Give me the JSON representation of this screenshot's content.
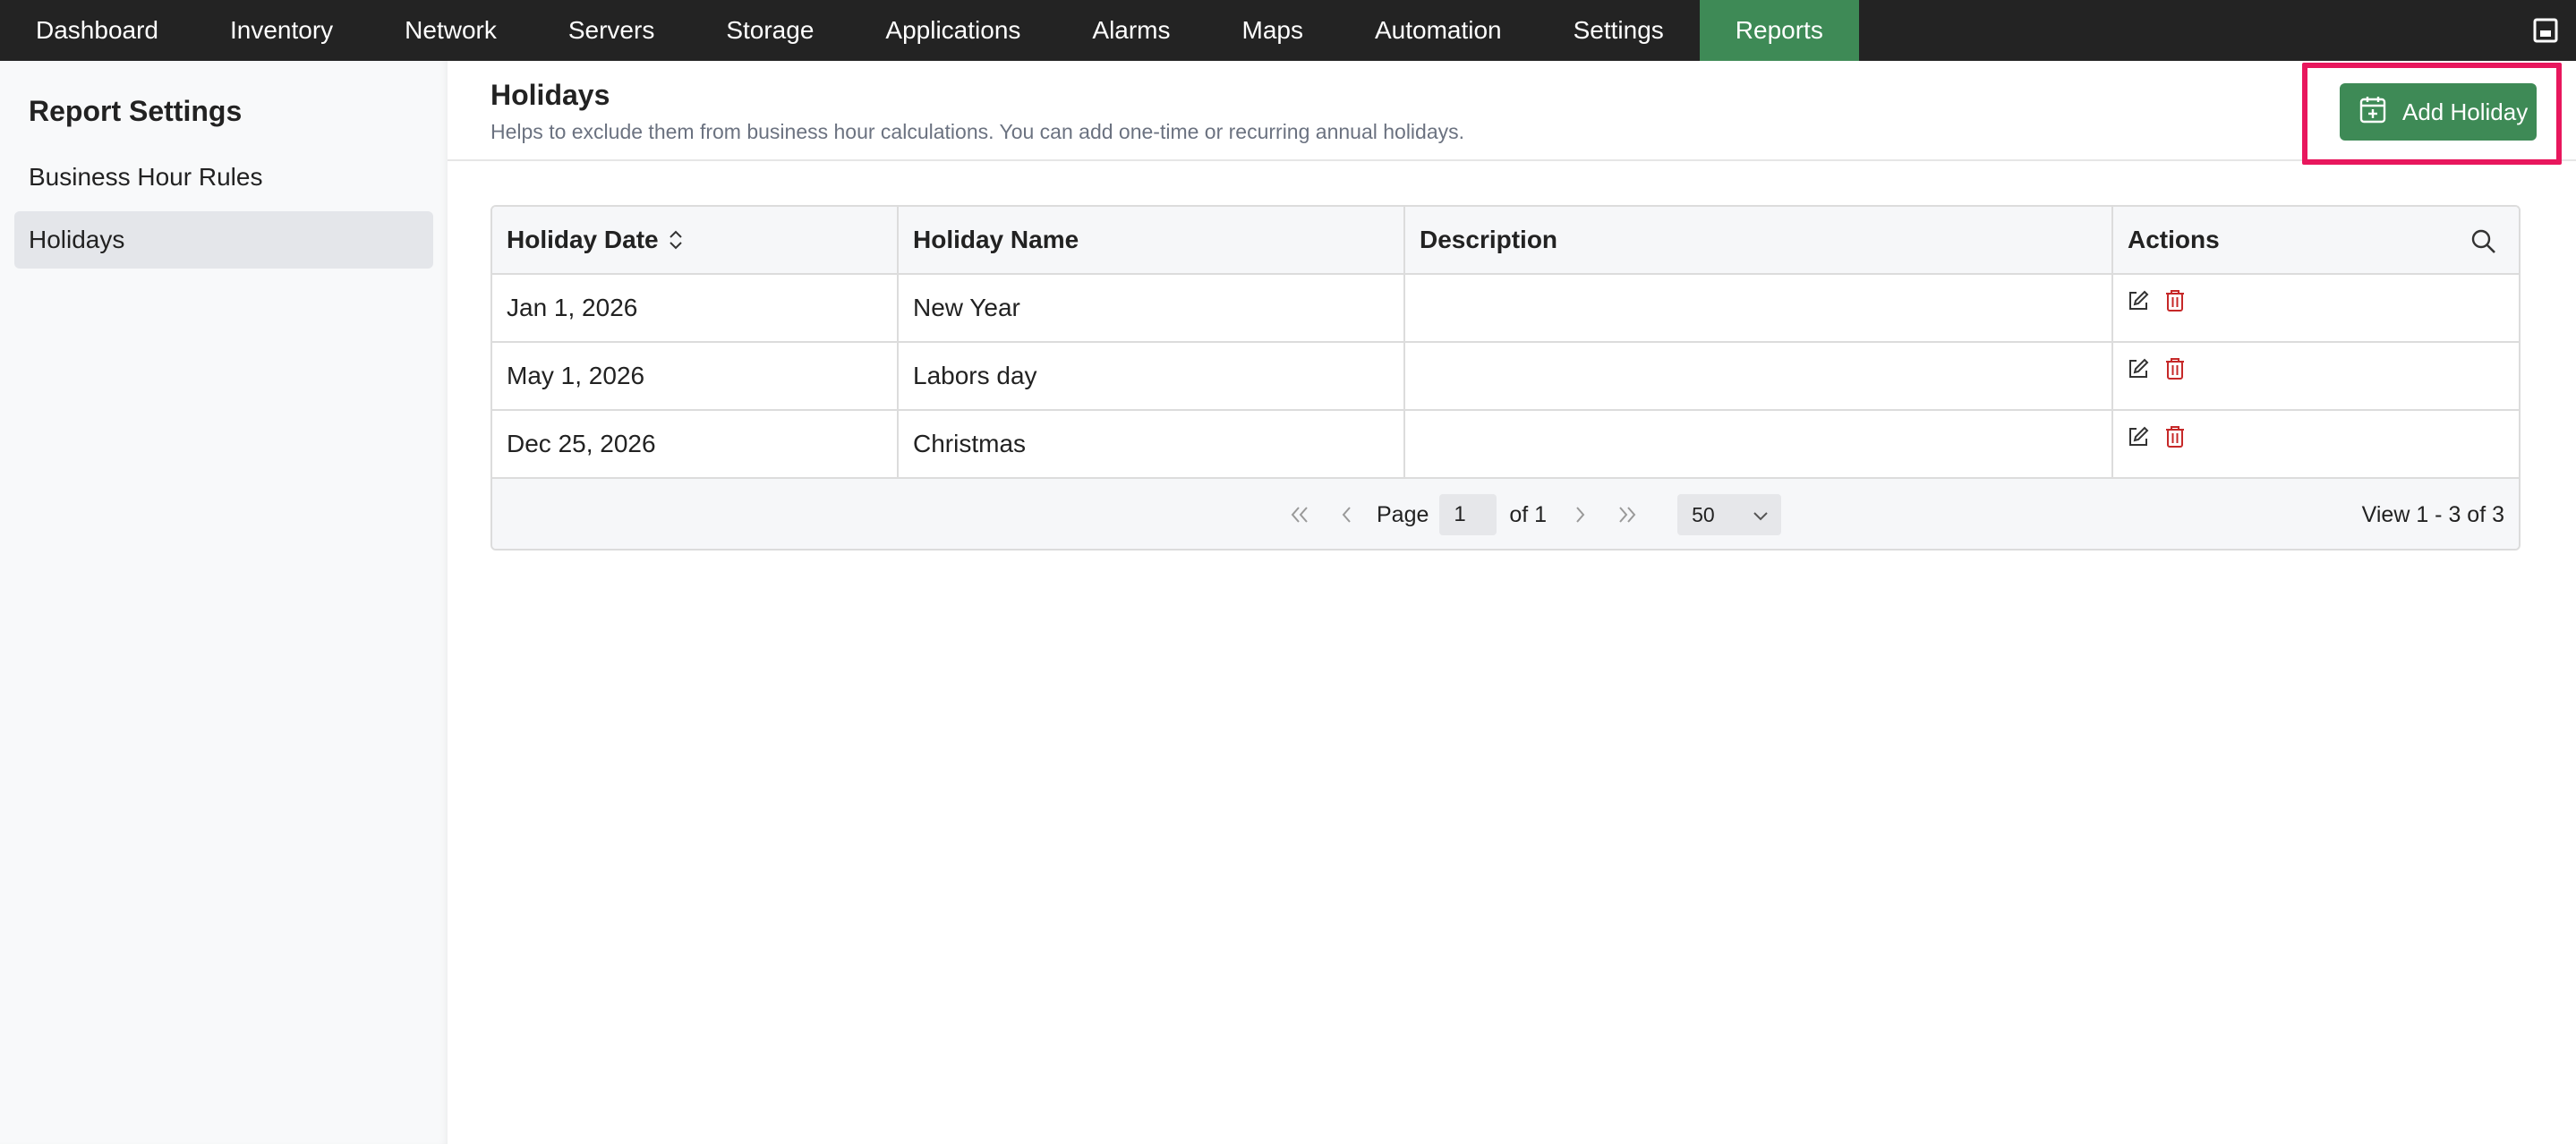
{
  "nav": {
    "tabs": [
      {
        "label": "Dashboard"
      },
      {
        "label": "Inventory"
      },
      {
        "label": "Network"
      },
      {
        "label": "Servers"
      },
      {
        "label": "Storage"
      },
      {
        "label": "Applications"
      },
      {
        "label": "Alarms"
      },
      {
        "label": "Maps"
      },
      {
        "label": "Automation"
      },
      {
        "label": "Settings"
      },
      {
        "label": "Reports"
      }
    ],
    "active_tab": "Reports"
  },
  "sidebar": {
    "title": "Report Settings",
    "items": [
      {
        "label": "Business Hour Rules"
      },
      {
        "label": "Holidays"
      }
    ],
    "active_item": "Holidays"
  },
  "header": {
    "title": "Holidays",
    "subtitle": "Helps to exclude them from business hour calculations. You can add one-time or recurring annual holidays.",
    "add_button_label": "Add Holiday"
  },
  "table": {
    "columns": [
      "Holiday Date",
      "Holiday Name",
      "Description",
      "Actions"
    ],
    "rows": [
      {
        "date": "Jan 1, 2026",
        "name": "New Year",
        "description": ""
      },
      {
        "date": "May 1, 2026",
        "name": "Labors day",
        "description": ""
      },
      {
        "date": "Dec 25, 2026",
        "name": "Christmas",
        "description": ""
      }
    ]
  },
  "pager": {
    "page_label": "Page",
    "page_value": "1",
    "of_label": "of 1",
    "page_size": "50",
    "view_text": "View 1 - 3 of 3"
  },
  "colors": {
    "nav_bg": "#232323",
    "accent_green": "#3e8a56",
    "highlight": "#e8175d",
    "delete_red": "#c62828"
  }
}
